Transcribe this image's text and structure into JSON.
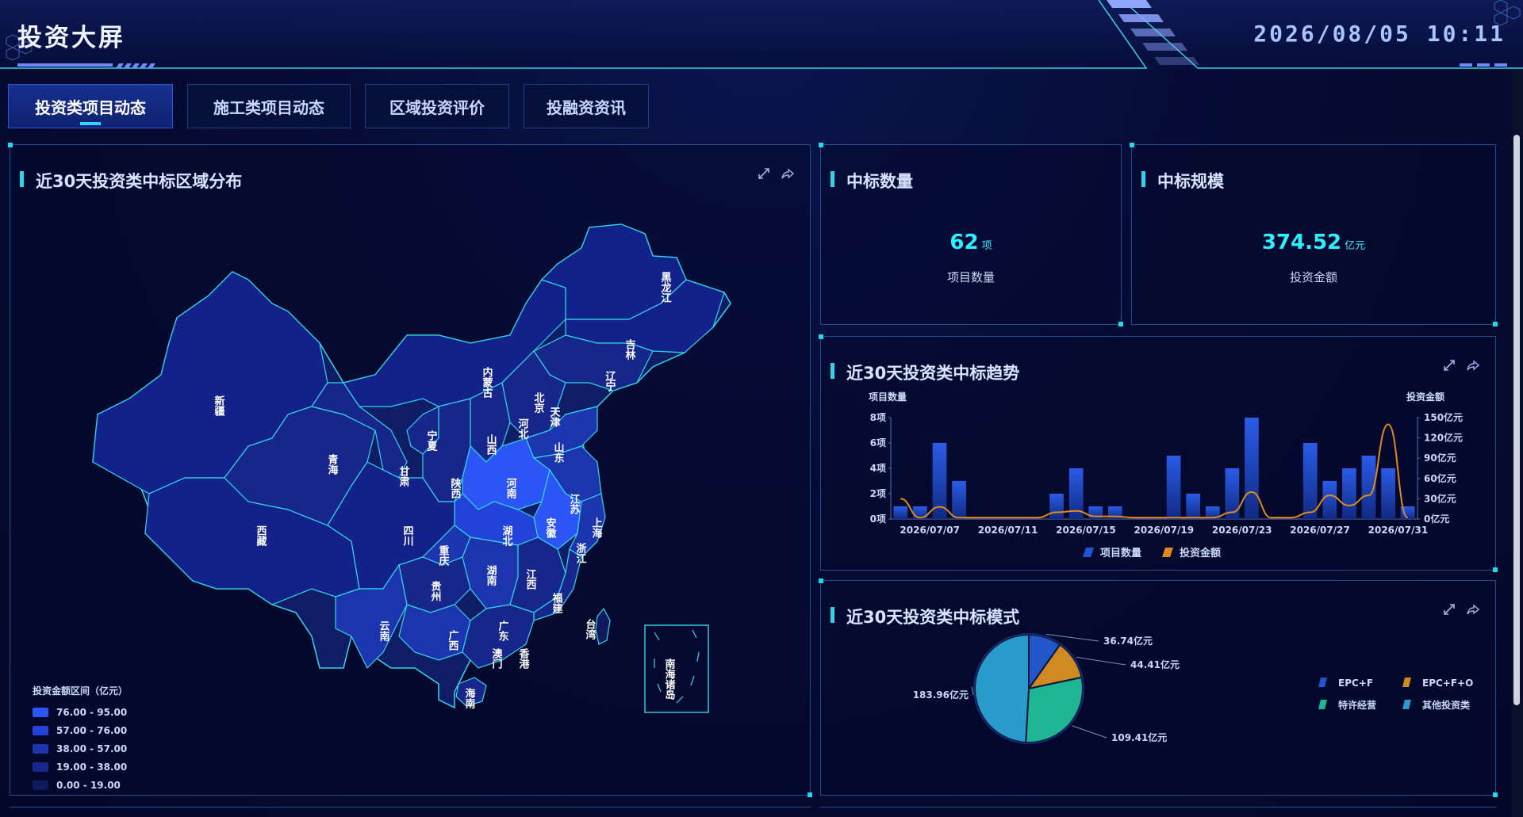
{
  "header": {
    "title": "投资大屏",
    "datetime": "2026/08/05  10:11"
  },
  "tabs": [
    {
      "label": "投资类项目动态",
      "active": true
    },
    {
      "label": "施工类项目动态",
      "active": false
    },
    {
      "label": "区域投资评价",
      "active": false
    },
    {
      "label": "投融资资讯",
      "active": false
    }
  ],
  "map_panel": {
    "title": "近30天投资类中标区域分布",
    "legend_title": "投资金额区间（亿元）",
    "legend": [
      {
        "label": "76.00 - 95.00",
        "color": "#2b55f5"
      },
      {
        "label": "57.00 - 76.00",
        "color": "#2343d8"
      },
      {
        "label": "38.00 - 57.00",
        "color": "#1c34ae"
      },
      {
        "label": "19.00 - 38.00",
        "color": "#16268a"
      },
      {
        "label": "0.00 - 19.00",
        "color": "#0f1a5e"
      }
    ],
    "provinces": [
      "新疆",
      "西藏",
      "青海",
      "甘肃",
      "内蒙古",
      "黑龙江",
      "吉林",
      "辽宁",
      "北京",
      "天津",
      "河北",
      "山西",
      "山东",
      "宁夏",
      "陕西",
      "河南",
      "江苏",
      "上海",
      "安徽",
      "湖北",
      "浙江",
      "四川",
      "重庆",
      "贵州",
      "湖南",
      "江西",
      "福建",
      "云南",
      "广西",
      "广东",
      "香港",
      "澳门",
      "海南",
      "台湾",
      "南海诸岛"
    ]
  },
  "count_card": {
    "title": "中标数量",
    "value": "62",
    "unit": "项",
    "label": "项目数量"
  },
  "scale_card": {
    "title": "中标规模",
    "value": "374.52",
    "unit": "亿元",
    "label": "投资金额"
  },
  "trend_panel": {
    "title": "近30天投资类中标趋势",
    "left_axis_title": "项目数量",
    "right_axis_title": "投资金额",
    "left_ticks": [
      "0项",
      "2项",
      "4项",
      "6项",
      "8项"
    ],
    "right_ticks": [
      "0亿元",
      "30亿元",
      "60亿元",
      "90亿元",
      "120亿元",
      "150亿元"
    ],
    "x_ticks": [
      "2026/07/07",
      "2026/07/11",
      "2026/07/15",
      "2026/07/19",
      "2026/07/23",
      "2026/07/27",
      "2026/07/31"
    ],
    "legend_bar": "项目数量",
    "legend_line": "投资金额"
  },
  "pie_panel": {
    "title": "近30天投资类中标模式",
    "legend": [
      {
        "label": "EPC+F",
        "color": "#2356c8"
      },
      {
        "label": "EPC+F+O",
        "color": "#d08a22"
      },
      {
        "label": "特许经营",
        "color": "#1fb694"
      },
      {
        "label": "其他投资类",
        "color": "#2a9ccc"
      }
    ]
  },
  "chart_data": [
    {
      "type": "bar",
      "title": "近30天投资类中标趋势",
      "categories": [
        "2026/07/07",
        "2026/07/08",
        "2026/07/09",
        "2026/07/10",
        "2026/07/11",
        "2026/07/12",
        "2026/07/13",
        "2026/07/14",
        "2026/07/15",
        "2026/07/16",
        "2026/07/17",
        "2026/07/18",
        "2026/07/19",
        "2026/07/20",
        "2026/07/21",
        "2026/07/22",
        "2026/07/23",
        "2026/07/24",
        "2026/07/25",
        "2026/07/26",
        "2026/07/27",
        "2026/07/28",
        "2026/07/29",
        "2026/07/30",
        "2026/07/31",
        "2026/08/01",
        "2026/08/02"
      ],
      "series": [
        {
          "name": "项目数量",
          "axis": "left",
          "values": [
            1,
            1,
            6,
            3,
            0,
            0,
            0,
            0,
            2,
            4,
            1,
            1,
            0,
            0,
            5,
            2,
            1,
            4,
            8,
            0,
            0,
            6,
            3,
            4,
            5,
            4,
            1
          ]
        },
        {
          "name": "投资金额",
          "axis": "right",
          "values": [
            30,
            2,
            18,
            2,
            2,
            2,
            2,
            2,
            10,
            12,
            4,
            4,
            2,
            2,
            2,
            2,
            2,
            10,
            40,
            2,
            2,
            10,
            35,
            20,
            35,
            140,
            2
          ]
        }
      ],
      "ylim_left": [
        0,
        8
      ],
      "ylim_right": [
        0,
        150
      ]
    },
    {
      "type": "pie",
      "title": "近30天投资类中标模式",
      "labels": [
        "EPC+F",
        "EPC+F+O",
        "特许经营",
        "其他投资类"
      ],
      "values": [
        36.74,
        44.41,
        109.41,
        183.96
      ],
      "value_labels": [
        "36.74亿元",
        "44.41亿元",
        "109.41亿元",
        "183.96亿元"
      ]
    }
  ]
}
